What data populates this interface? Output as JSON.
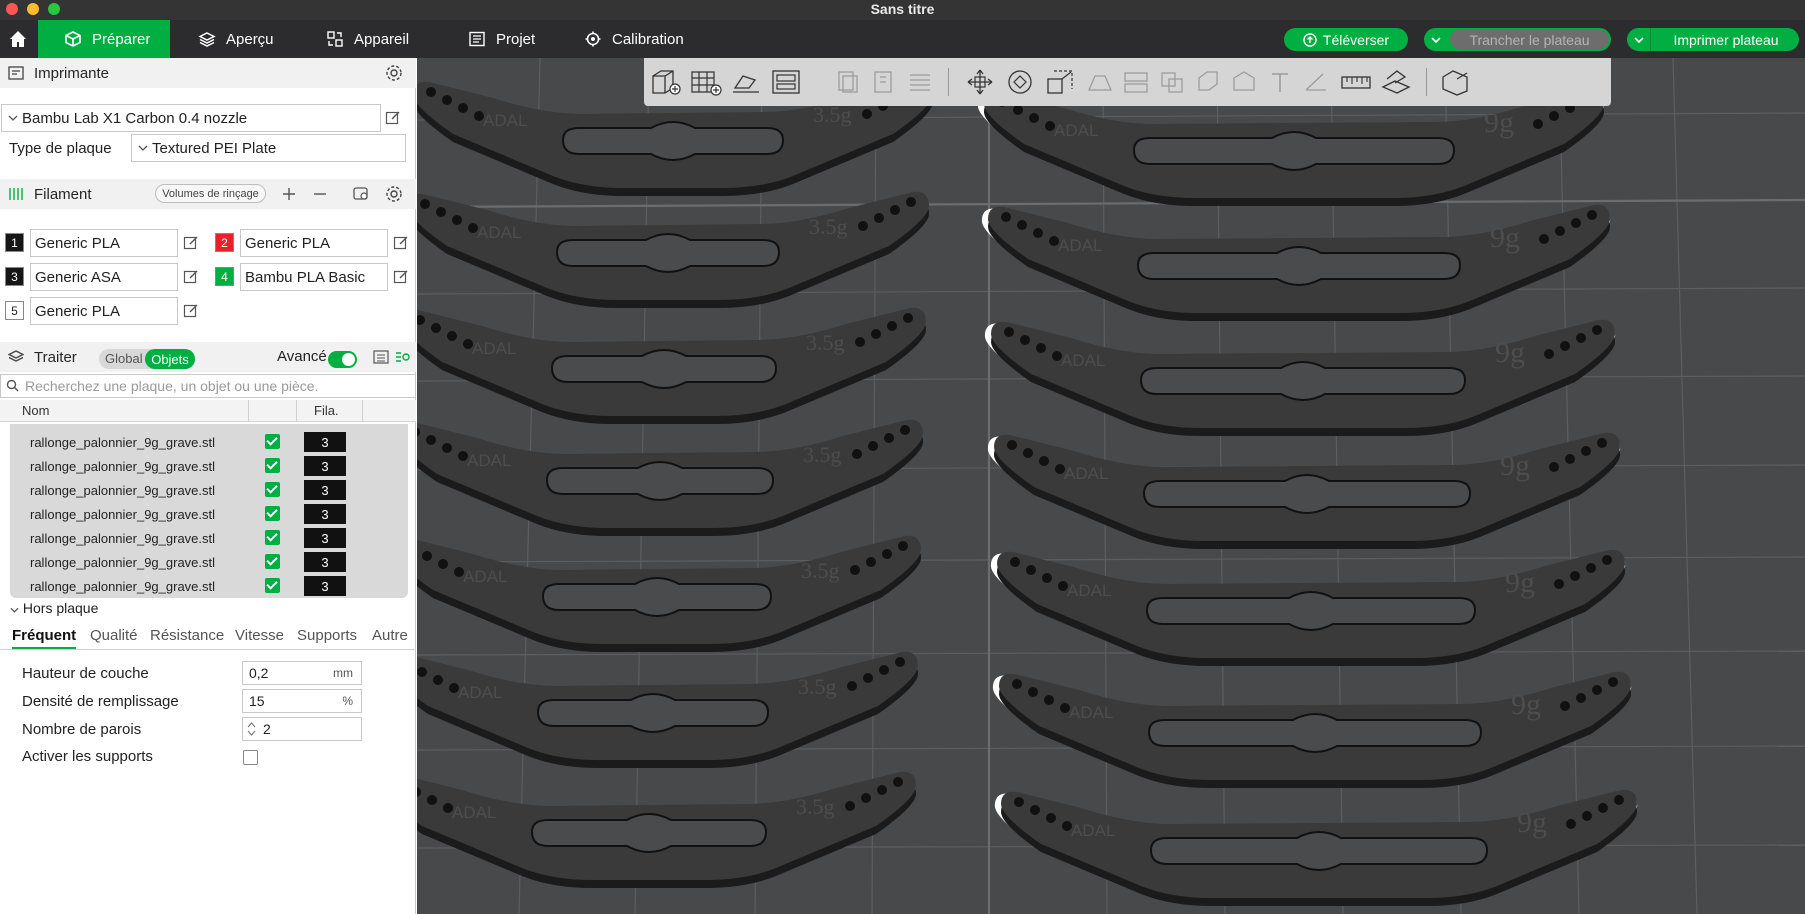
{
  "window": {
    "title": "Sans titre"
  },
  "colors": {
    "accent": "#00ae42",
    "topbar": "#2c2c2e",
    "viewport": "#48494b"
  },
  "tabs": [
    {
      "label": "Préparer",
      "icon": "cube-icon",
      "active": true
    },
    {
      "label": "Aperçu",
      "icon": "layers-icon",
      "active": false
    },
    {
      "label": "Appareil",
      "icon": "device-icon",
      "active": false
    },
    {
      "label": "Projet",
      "icon": "project-icon",
      "active": false
    },
    {
      "label": "Calibration",
      "icon": "calibration-icon",
      "active": false
    }
  ],
  "actions": {
    "upload": "Téléverser",
    "slice": "Trancher le plateau",
    "print": "Imprimer plateau"
  },
  "printer": {
    "section_title": "Imprimante",
    "name": "Bambu Lab X1 Carbon 0.4 nozzle",
    "plate_label": "Type de plaque",
    "plate_value": "Textured PEI Plate"
  },
  "filament": {
    "section_title": "Filament",
    "rinse_button": "Volumes de rinçage",
    "items": [
      {
        "num": "1",
        "name": "Generic PLA",
        "color": "#161616"
      },
      {
        "num": "2",
        "name": "Generic PLA",
        "color": "#e8202a"
      },
      {
        "num": "3",
        "name": "Generic ASA",
        "color": "#161616"
      },
      {
        "num": "4",
        "name": "Bambu PLA Basic",
        "color": "#00ae42"
      },
      {
        "num": "5",
        "name": "Generic PLA",
        "color": "#ffffff"
      }
    ]
  },
  "process": {
    "section_title": "Traiter",
    "seg_global": "Global",
    "seg_objects": "Objets",
    "advanced_label": "Avancé",
    "advanced_on": true,
    "search_placeholder": "Recherchez une plaque, un objet ou une pièce.",
    "col_name": "Nom",
    "col_fila": "Fila.",
    "objects": [
      {
        "name": "rallonge_palonnier_9g_grave.stl",
        "filament": "3"
      },
      {
        "name": "rallonge_palonnier_9g_grave.stl",
        "filament": "3"
      },
      {
        "name": "rallonge_palonnier_9g_grave.stl",
        "filament": "3"
      },
      {
        "name": "rallonge_palonnier_9g_grave.stl",
        "filament": "3"
      },
      {
        "name": "rallonge_palonnier_9g_grave.stl",
        "filament": "3"
      },
      {
        "name": "rallonge_palonnier_9g_grave.stl",
        "filament": "3"
      },
      {
        "name": "rallonge_palonnier_9g_grave.stl",
        "filament": "3"
      }
    ],
    "off_plate": "Hors plaque",
    "subtabs": [
      "Fréquent",
      "Qualité",
      "Résistance",
      "Vitesse",
      "Supports",
      "Autre"
    ],
    "params": {
      "layer_height_label": "Hauteur de couche",
      "layer_height": "0,2",
      "layer_unit": "mm",
      "infill_label": "Densité de remplissage",
      "infill": "15",
      "infill_unit": "%",
      "walls_label": "Nombre de parois",
      "walls": "2",
      "supports_label": "Activer les supports",
      "supports_enabled": false
    }
  },
  "plate_parts": {
    "left_brand": "ADAL",
    "left_weight": "3.5g",
    "right_brand": "ADAL",
    "right_weight": "9g"
  }
}
